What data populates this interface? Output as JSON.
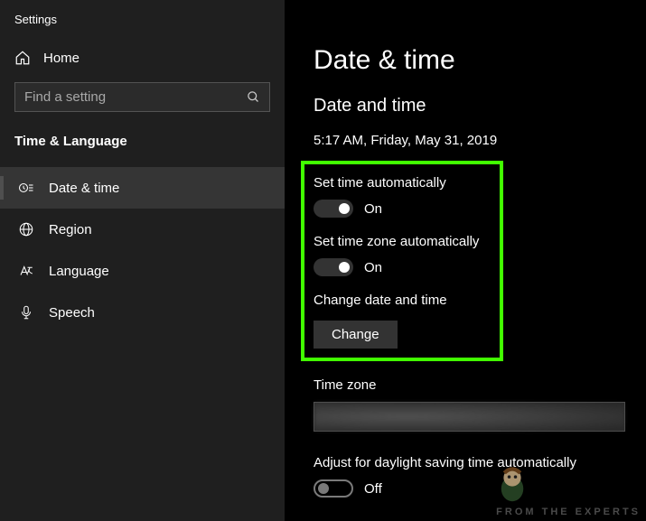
{
  "app_title": "Settings",
  "home_label": "Home",
  "search": {
    "placeholder": "Find a setting"
  },
  "category_title": "Time & Language",
  "nav": [
    {
      "label": "Date & time",
      "icon": "clock-text-icon",
      "active": true
    },
    {
      "label": "Region",
      "icon": "globe-icon",
      "active": false
    },
    {
      "label": "Language",
      "icon": "language-icon",
      "active": false
    },
    {
      "label": "Speech",
      "icon": "microphone-icon",
      "active": false
    }
  ],
  "main": {
    "page_title": "Date & time",
    "section_title": "Date and time",
    "current_datetime": "5:17 AM, Friday, May 31, 2019",
    "set_time_auto": {
      "label": "Set time automatically",
      "state": "On",
      "on": true
    },
    "set_tz_auto": {
      "label": "Set time zone automatically",
      "state": "On",
      "on": true
    },
    "change_dt": {
      "label": "Change date and time",
      "button": "Change"
    },
    "timezone": {
      "label": "Time zone"
    },
    "dst": {
      "label": "Adjust for daylight saving time automatically",
      "state": "Off",
      "on": false
    }
  },
  "watermark": "FROM THE EXPERTS"
}
